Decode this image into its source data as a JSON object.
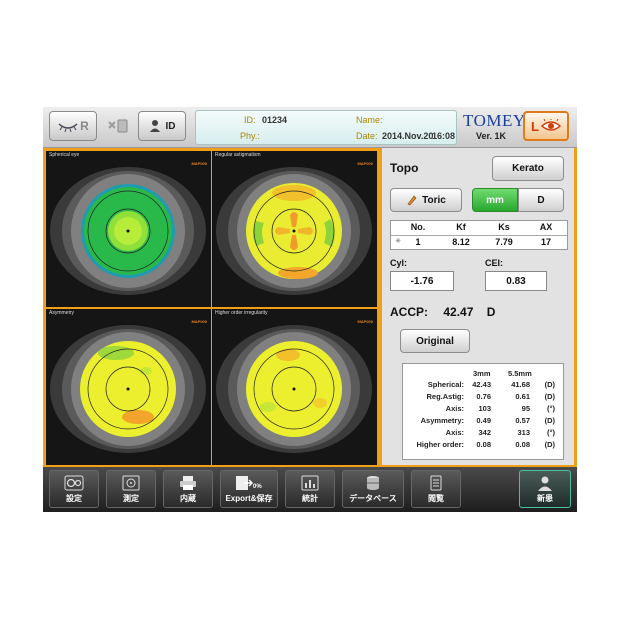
{
  "header": {
    "r_label": "R",
    "id_button_label": "ID",
    "id_label": "ID:",
    "id_value": "01234",
    "name_label": "Name:",
    "name_value": "",
    "phy_label": "Phy.:",
    "phy_value": "",
    "date_label": "Date:",
    "date_value": "2014.Nov.20",
    "time_value": "16:08",
    "brand": "TOMEY",
    "version": "Ver. 1K",
    "l_label": "L"
  },
  "maps": [
    {
      "title": "Spherical eye",
      "tag": "MAP000"
    },
    {
      "title": "Regular astigmatism",
      "tag": "MAP000"
    },
    {
      "title": "Asymmetry",
      "tag": "MAP000"
    },
    {
      "title": "Higher order irregularity",
      "tag": "MAP000"
    }
  ],
  "right": {
    "topo_label": "Topo",
    "kerato_button": "Kerato",
    "toric_button": "Toric",
    "mm_button": "mm",
    "d_button": "D",
    "table_headers": [
      "No.",
      "Kf",
      "Ks",
      "AX"
    ],
    "table_row": {
      "no": "1",
      "kf": "8.12",
      "ks": "7.79",
      "ax": "17"
    },
    "cyl_label": "Cyl:",
    "cyl_value": "-1.76",
    "cei_label": "CEI:",
    "cei_value": "0.83",
    "accp_label": "ACCP:",
    "accp_value": "42.47",
    "accp_unit": "D",
    "original_button": "Original"
  },
  "stats": {
    "col1": "3mm",
    "col2": "5.5mm",
    "rows": [
      {
        "label": "Spherical:",
        "v1": "42.43",
        "v2": "41.68",
        "unit": "(D)"
      },
      {
        "label": "Reg.Astig:",
        "v1": "0.76",
        "v2": "0.61",
        "unit": "(D)"
      },
      {
        "label": "Axis:",
        "v1": "103",
        "v2": "95",
        "unit": "(°)"
      },
      {
        "label": "Asymmetry:",
        "v1": "0.49",
        "v2": "0.57",
        "unit": "(D)"
      },
      {
        "label": "Axis:",
        "v1": "342",
        "v2": "313",
        "unit": "(°)"
      },
      {
        "label": "Higher order:",
        "v1": "0.08",
        "v2": "0.08",
        "unit": "(D)"
      }
    ]
  },
  "toolbar": {
    "settings": "設定",
    "measure": "測定",
    "internal": "内蔵",
    "export": "Export&保存",
    "export_pct": "0%",
    "stats": "統計",
    "database": "データベース",
    "view": "閲覧",
    "new_patient": "新患"
  },
  "colors": {
    "accent_orange": "#f0a018",
    "green": "#2bbd3a",
    "yellow": "#f0ef2e",
    "brand_blue": "#1a3f9e"
  }
}
